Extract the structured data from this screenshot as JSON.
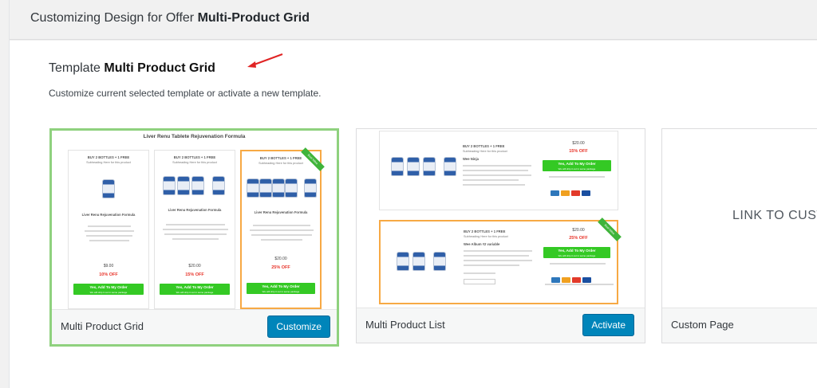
{
  "header": {
    "prefix": "Customizing Design for Offer",
    "offer_name": "Multi-Product Grid"
  },
  "template": {
    "prefix": "Template",
    "name": "Multi Product Grid",
    "description": "Customize current selected template or activate a new template."
  },
  "cards": [
    {
      "name": "Multi Product Grid",
      "button": "Customize",
      "preview": {
        "title": "Liver Renu Tablete Rejuvenation Formula",
        "columns": [
          {
            "head": "BUY 2 BOTTLES + 1 FREE",
            "sub": "Subheading Here for this product",
            "product": "Liver Renu Rejuvenation Formula",
            "price": "$9.00",
            "off": "10% OFF",
            "btn": "Yes, Add To My Order",
            "btn_sub": "We will ship it out in same package"
          },
          {
            "head": "BUY 2 BOTTLES + 1 FREE",
            "sub": "Subheading Here for this product",
            "product": "Liver Renu Rejuvenation Formula",
            "price": "$20.00",
            "off": "15% OFF",
            "btn": "Yes, Add To My Order",
            "btn_sub": "We will ship it out in same package"
          },
          {
            "head": "BUY 2 BOTTLES + 1 FREE",
            "sub": "Subheading Here for this product",
            "product": "Liver Renu Rejuvenation Formula",
            "price": "$20.00",
            "off": "25% OFF",
            "btn": "Yes, Add To My Order",
            "btn_sub": "We will ship it out in same package",
            "ribbon": "Best Value"
          }
        ]
      }
    },
    {
      "name": "Multi Product List",
      "button": "Activate",
      "preview": {
        "rows": [
          {
            "head": "BUY 2 BOTTLES + 1 FREE",
            "sub": "Subheading Here for this product",
            "product": "Wee Ninja",
            "price": "$20.00",
            "off": "15% OFF",
            "btn": "Yes, Add To My Order",
            "btn_sub": "We will ship it out in same package"
          },
          {
            "head": "BUY 2 BOTTLES + 1 FREE",
            "sub": "Subheading Here for this product",
            "product": "Wee Album #2 variable",
            "price": "$20.00",
            "off": "25% OFF",
            "btn": "Yes, Add To My Order",
            "btn_sub": "We will ship it out in same package",
            "ribbon": "Best Value"
          }
        ]
      }
    },
    {
      "name": "Custom Page",
      "preview_text": "LINK TO CUST"
    }
  ],
  "colors": {
    "accent_button": "#0085ba",
    "selected_border": "#8fd17e",
    "highlight_border": "#f7a944",
    "offer_green": "#34c924",
    "discount_red": "#e8352b",
    "arrow_red": "#e02424"
  }
}
